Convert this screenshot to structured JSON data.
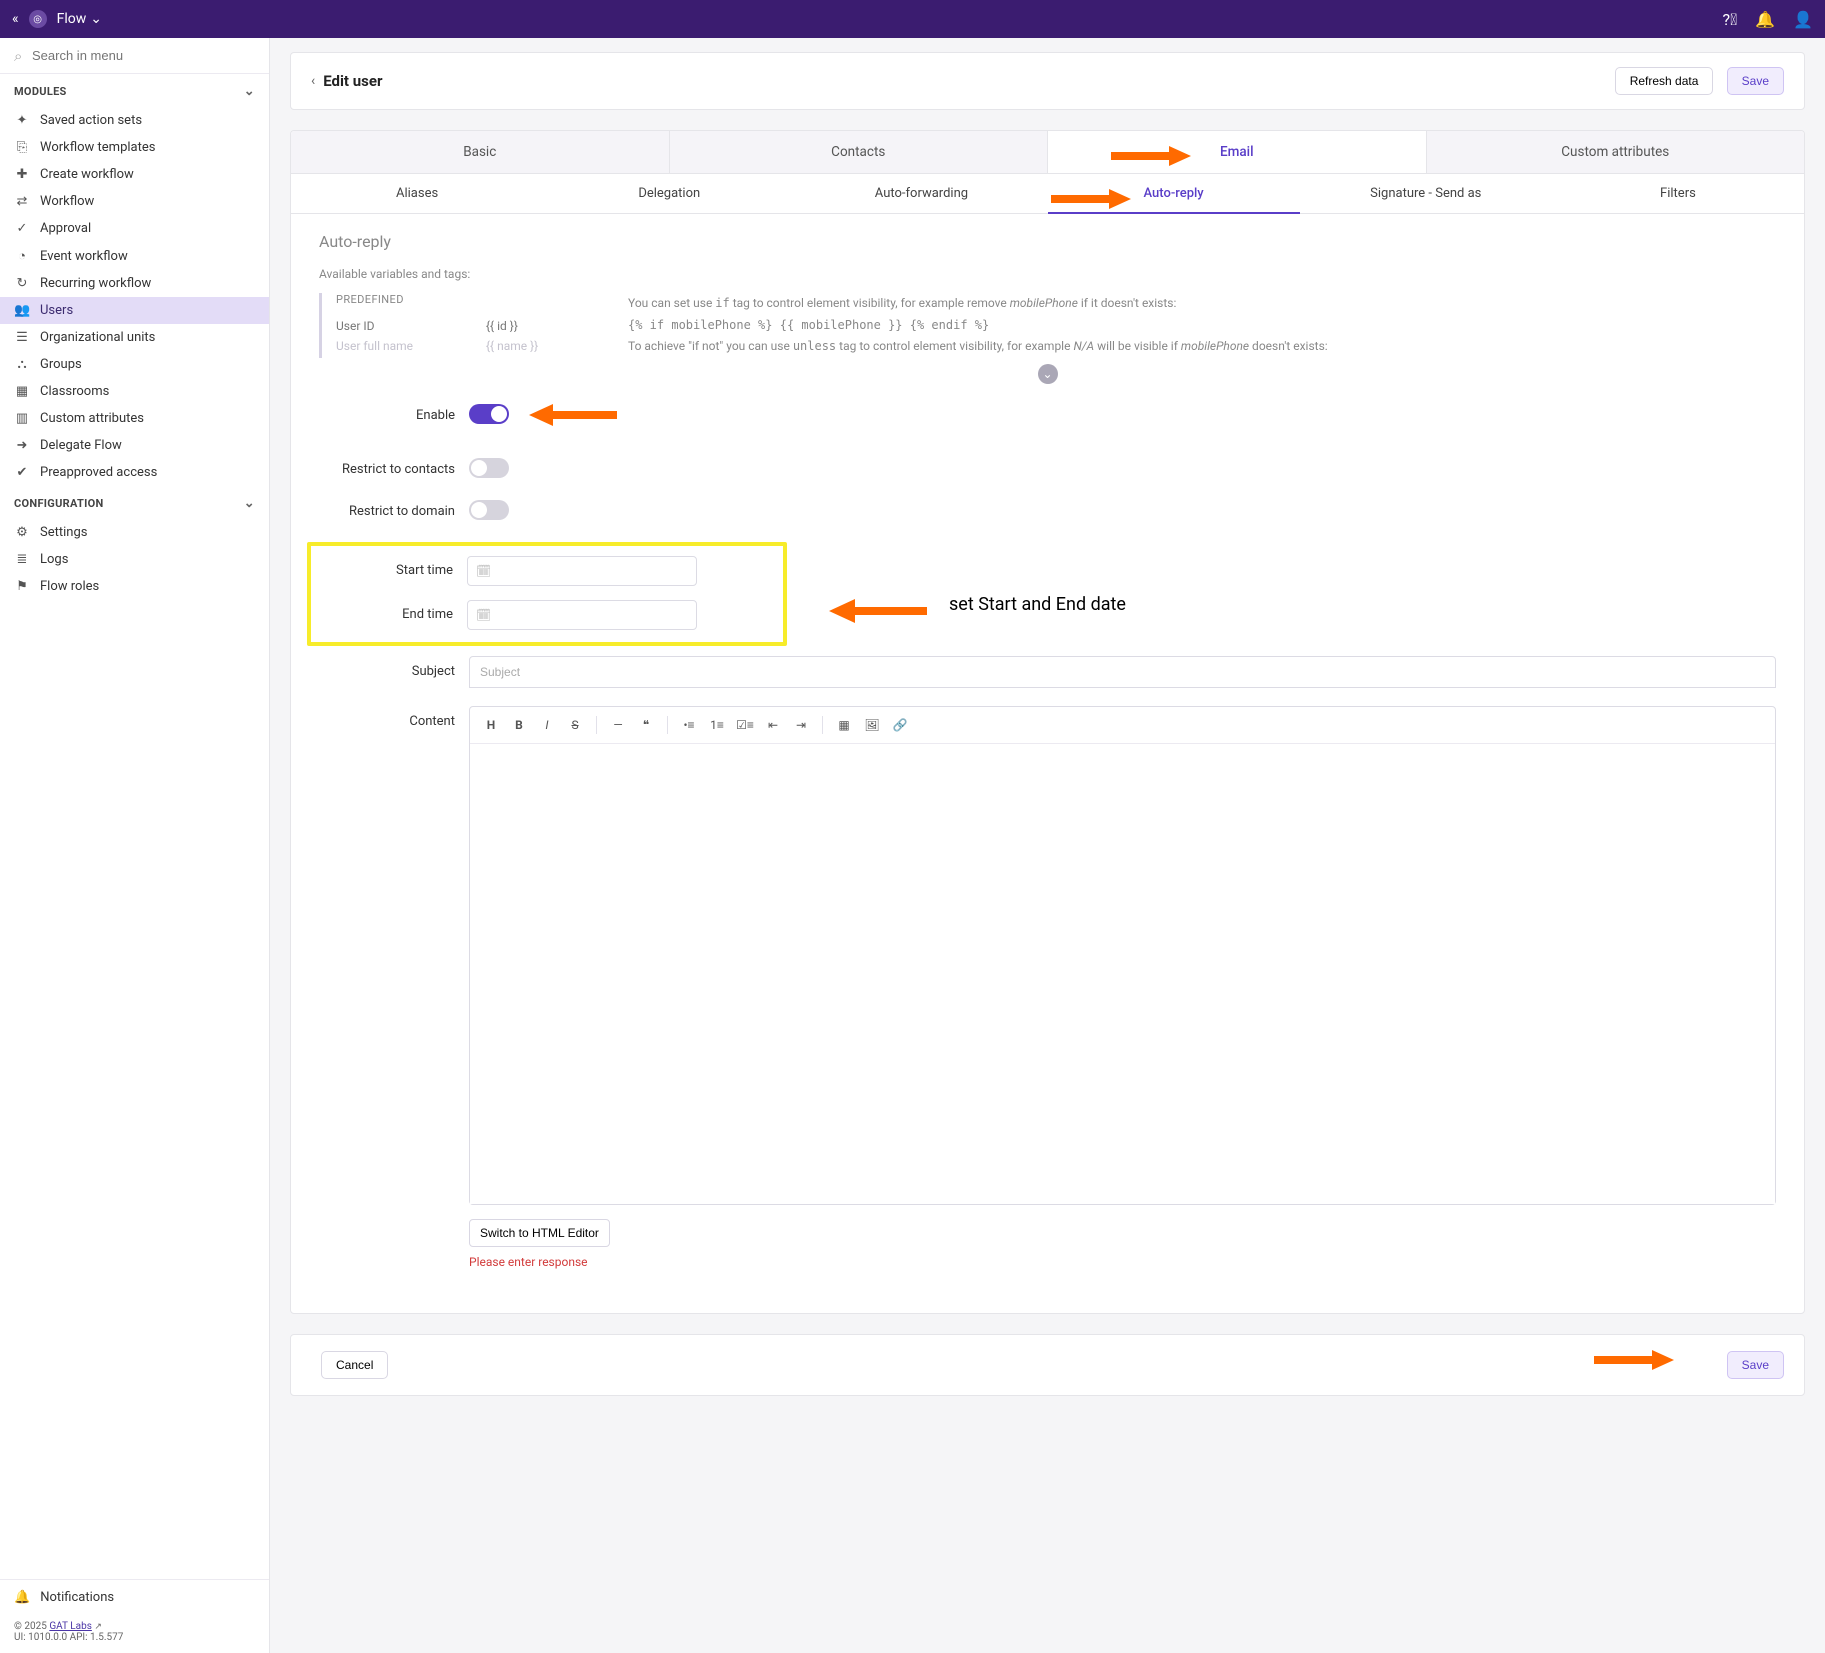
{
  "topbar": {
    "app_name": "Flow"
  },
  "sidebar": {
    "search_placeholder": "Search in menu",
    "sections": {
      "modules": "MODULES",
      "configuration": "CONFIGURATION"
    },
    "modules": [
      {
        "icon": "✦",
        "label": "Saved action sets"
      },
      {
        "icon": "⎘",
        "label": "Workflow templates"
      },
      {
        "icon": "✚",
        "label": "Create workflow"
      },
      {
        "icon": "⇄",
        "label": "Workflow"
      },
      {
        "icon": "✓",
        "label": "Approval"
      },
      {
        "icon": "◔",
        "label": "Event workflow"
      },
      {
        "icon": "↻",
        "label": "Recurring workflow"
      },
      {
        "icon": "👥",
        "label": "Users",
        "active": true
      },
      {
        "icon": "☰",
        "label": "Organizational units"
      },
      {
        "icon": "⛬",
        "label": "Groups"
      },
      {
        "icon": "▦",
        "label": "Classrooms"
      },
      {
        "icon": "▥",
        "label": "Custom attributes"
      },
      {
        "icon": "➜",
        "label": "Delegate Flow"
      },
      {
        "icon": "✔",
        "label": "Preapproved access"
      }
    ],
    "configuration": [
      {
        "icon": "⚙",
        "label": "Settings"
      },
      {
        "icon": "≣",
        "label": "Logs"
      },
      {
        "icon": "⚑",
        "label": "Flow roles"
      }
    ],
    "notifications": "Notifications",
    "footer": {
      "copyright": "© 2025 ",
      "link": "GAT Labs",
      "version": "UI: 1010.0.0 API: 1.5.577"
    }
  },
  "page": {
    "title": "Edit user",
    "refresh": "Refresh data",
    "save": "Save"
  },
  "tabs_l1": [
    "Basic",
    "Contacts",
    "Email",
    "Custom attributes"
  ],
  "tabs_l2": [
    "Aliases",
    "Delegation",
    "Auto-forwarding",
    "Auto-reply",
    "Signature - Send as",
    "Filters"
  ],
  "panel": {
    "title": "Auto-reply",
    "hint": "Available variables and tags:",
    "predefined_label": "PREDEFINED",
    "vars": [
      {
        "name": "User ID",
        "token": "{{ id }}"
      },
      {
        "name": "User full name",
        "token": "{{ name }}"
      }
    ],
    "help_line1_a": "You can set use ",
    "help_line1_code1": "if",
    "help_line1_b": " tag to control element visibility, for example remove ",
    "help_line1_em": "mobilePhone",
    "help_line1_c": " if it doesn't exists:",
    "help_code": "{% if mobilePhone %} {{ mobilePhone }} {% endif %}",
    "help_line2_a": "To achieve \"if not\" you can use ",
    "help_line2_code": "unless",
    "help_line2_b": " tag to control element visibility, for example ",
    "help_line2_em1": "N/A",
    "help_line2_c": " will be visible if ",
    "help_line2_em2": "mobilePhone",
    "help_line2_d": " doesn't exists:"
  },
  "form": {
    "enable": "Enable",
    "restrict_contacts": "Restrict to contacts",
    "restrict_domain": "Restrict to domain",
    "start_time": "Start time",
    "end_time": "End time",
    "subject": "Subject",
    "subject_placeholder": "Subject",
    "content": "Content",
    "switch_html": "Switch to HTML Editor",
    "error": "Please enter response"
  },
  "footer_card": {
    "cancel": "Cancel",
    "save": "Save"
  },
  "annotations": {
    "dates": "set Start and End date"
  }
}
